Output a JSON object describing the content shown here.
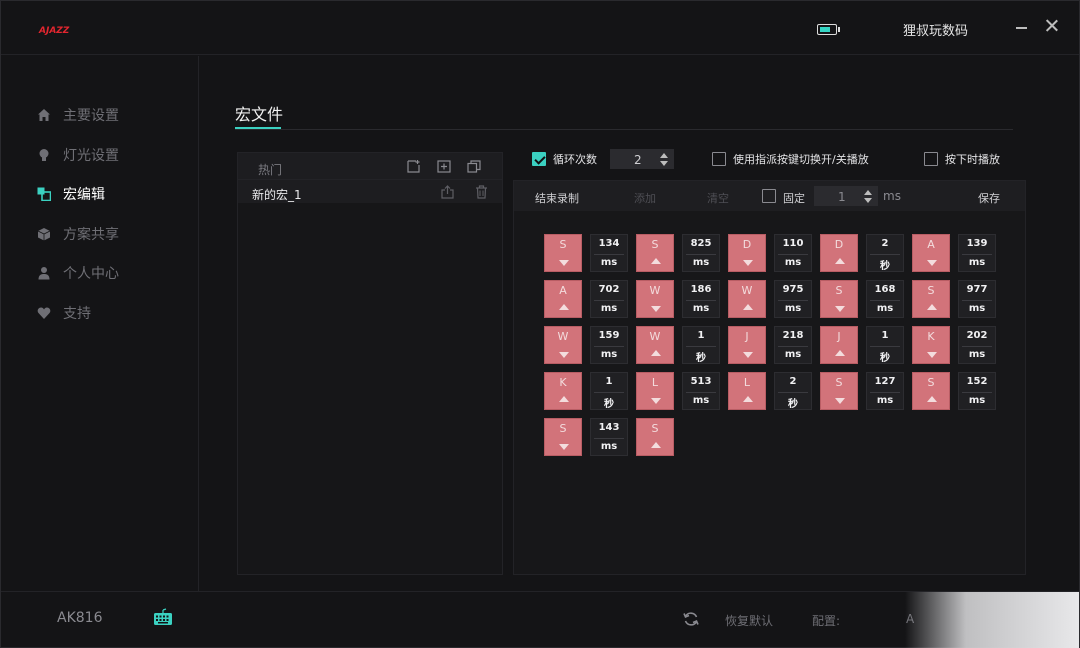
{
  "app": {
    "logo_text": "AJAZZ",
    "user_name": "狸叔玩数码",
    "battery_level": 0.75
  },
  "sidebar": {
    "items": [
      {
        "label": "主要设置",
        "icon": "home-icon",
        "active": false
      },
      {
        "label": "灯光设置",
        "icon": "bulb-icon",
        "active": false
      },
      {
        "label": "宏编辑",
        "icon": "macro-icon",
        "active": true
      },
      {
        "label": "方案共享",
        "icon": "cube-icon",
        "active": false
      },
      {
        "label": "个人中心",
        "icon": "user-icon",
        "active": false
      },
      {
        "label": "支持",
        "icon": "heart-icon",
        "active": false
      }
    ]
  },
  "main": {
    "section_title": "宏文件"
  },
  "macro_list": {
    "header_label": "热门",
    "items": [
      {
        "name": "新的宏_1"
      }
    ]
  },
  "options": {
    "loop_label": "循环次数",
    "loop_checked": true,
    "loop_count": "2",
    "toggle_label": "使用指派按键切换开/关播放",
    "toggle_checked": false,
    "hold_label": "按下时播放",
    "hold_checked": false
  },
  "toolbar": {
    "stop_record": "结束录制",
    "add": "添加",
    "clear": "清空",
    "fixed_label": "固定",
    "fixed_checked": false,
    "fixed_value": "1",
    "fixed_unit": "ms",
    "save": "保存"
  },
  "macro_steps": [
    {
      "type": "key",
      "key": "S",
      "dir": "down"
    },
    {
      "type": "delay",
      "value": "134",
      "unit": "ms"
    },
    {
      "type": "key",
      "key": "S",
      "dir": "up"
    },
    {
      "type": "delay",
      "value": "825",
      "unit": "ms"
    },
    {
      "type": "key",
      "key": "D",
      "dir": "down"
    },
    {
      "type": "delay",
      "value": "110",
      "unit": "ms"
    },
    {
      "type": "key",
      "key": "D",
      "dir": "up"
    },
    {
      "type": "delay",
      "value": "2",
      "unit": "秒"
    },
    {
      "type": "key",
      "key": "A",
      "dir": "down"
    },
    {
      "type": "delay",
      "value": "139",
      "unit": "ms"
    },
    {
      "type": "key",
      "key": "A",
      "dir": "up"
    },
    {
      "type": "delay",
      "value": "702",
      "unit": "ms"
    },
    {
      "type": "key",
      "key": "W",
      "dir": "down"
    },
    {
      "type": "delay",
      "value": "186",
      "unit": "ms"
    },
    {
      "type": "key",
      "key": "W",
      "dir": "up"
    },
    {
      "type": "delay",
      "value": "975",
      "unit": "ms"
    },
    {
      "type": "key",
      "key": "S",
      "dir": "down"
    },
    {
      "type": "delay",
      "value": "168",
      "unit": "ms"
    },
    {
      "type": "key",
      "key": "S",
      "dir": "up"
    },
    {
      "type": "delay",
      "value": "977",
      "unit": "ms"
    },
    {
      "type": "key",
      "key": "W",
      "dir": "down"
    },
    {
      "type": "delay",
      "value": "159",
      "unit": "ms"
    },
    {
      "type": "key",
      "key": "W",
      "dir": "up"
    },
    {
      "type": "delay",
      "value": "1",
      "unit": "秒"
    },
    {
      "type": "key",
      "key": "J",
      "dir": "down"
    },
    {
      "type": "delay",
      "value": "218",
      "unit": "ms"
    },
    {
      "type": "key",
      "key": "J",
      "dir": "up"
    },
    {
      "type": "delay",
      "value": "1",
      "unit": "秒"
    },
    {
      "type": "key",
      "key": "K",
      "dir": "down"
    },
    {
      "type": "delay",
      "value": "202",
      "unit": "ms"
    },
    {
      "type": "key",
      "key": "K",
      "dir": "up"
    },
    {
      "type": "delay",
      "value": "1",
      "unit": "秒"
    },
    {
      "type": "key",
      "key": "L",
      "dir": "down"
    },
    {
      "type": "delay",
      "value": "513",
      "unit": "ms"
    },
    {
      "type": "key",
      "key": "L",
      "dir": "up"
    },
    {
      "type": "delay",
      "value": "2",
      "unit": "秒"
    },
    {
      "type": "key",
      "key": "S",
      "dir": "down"
    },
    {
      "type": "delay",
      "value": "127",
      "unit": "ms"
    },
    {
      "type": "key",
      "key": "S",
      "dir": "up"
    },
    {
      "type": "delay",
      "value": "152",
      "unit": "ms"
    },
    {
      "type": "key",
      "key": "S",
      "dir": "down"
    },
    {
      "type": "delay",
      "value": "143",
      "unit": "ms"
    },
    {
      "type": "key",
      "key": "S",
      "dir": "up"
    }
  ],
  "footer": {
    "device_name": "AK816",
    "reset_label": "恢复默认",
    "config_label": "配置:",
    "config_value_partial": "A"
  },
  "colors": {
    "accent": "#3bd1c1",
    "key_cell": "#d2737a",
    "background": "#141416"
  }
}
